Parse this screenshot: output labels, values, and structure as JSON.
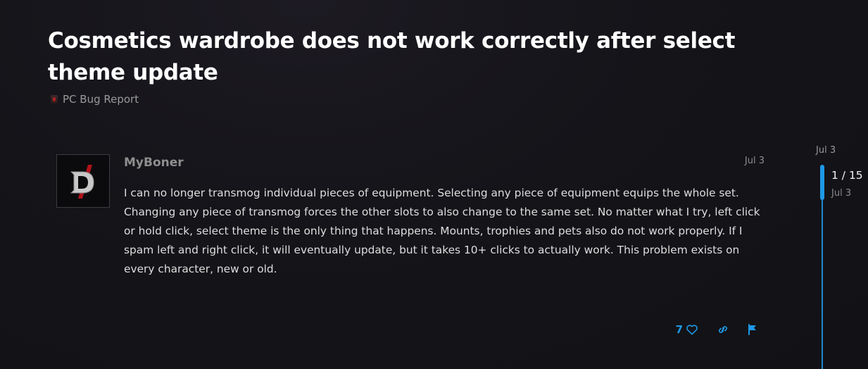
{
  "topic": {
    "title": "Cosmetics wardrobe does not work correctly after select theme update",
    "category": "PC Bug Report"
  },
  "post": {
    "username": "MyBoner",
    "date": "Jul 3",
    "avatar_letter": "D",
    "body": "I can no longer transmog individual pieces of equipment. Selecting any piece of equipment equips the whole set. Changing any piece of transmog forces the other slots to also change to the same set. No matter what I try, left click or hold click, select theme is the only thing that happens. Mounts, trophies and pets also do not work properly. If I spam left and right click, it will eventually update, but it takes 10+ clicks to actually work. This problem exists on every character, new or old.",
    "like_count": "7",
    "icons": {
      "like": "heart-icon",
      "link": "link-icon",
      "flag": "flag-icon"
    }
  },
  "timeline": {
    "start_date": "Jul 3",
    "position": "1 / 15",
    "current_date": "Jul 3"
  },
  "colors": {
    "accent": "#1e98e6",
    "background": "#141419",
    "title": "#ffffff",
    "muted": "#8e8e8e"
  }
}
